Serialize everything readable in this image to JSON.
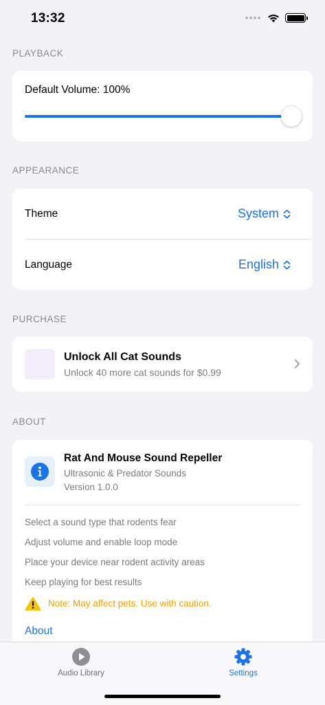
{
  "status_bar": {
    "time": "13:32"
  },
  "playback": {
    "header": "PLAYBACK",
    "volume_label": "Default Volume: 100%",
    "volume_value": 1.0
  },
  "appearance": {
    "header": "APPEARANCE",
    "theme_label": "Theme",
    "theme_value": "System",
    "language_label": "Language",
    "language_value": "English"
  },
  "purchase": {
    "header": "PURCHASE",
    "title": "Unlock All Cat Sounds",
    "subtitle": "Unlock 40 more cat sounds for $0.99"
  },
  "about": {
    "header": "ABOUT",
    "app_name": "Rat And Mouse Sound Repeller",
    "app_subtitle": "Ultrasonic & Predator Sounds",
    "version": "Version 1.0.0",
    "tips": [
      "Select a sound type that rodents fear",
      "Adjust volume and enable loop mode",
      "Place your device near rodent activity areas",
      "Keep playing for best results"
    ],
    "warning": "Note: May affect pets. Use with caution.",
    "about_link": "About"
  },
  "tab_bar": {
    "tabs": [
      {
        "label": "Audio Library",
        "icon": "play-circle-icon",
        "active": false
      },
      {
        "label": "Settings",
        "icon": "gear-icon",
        "active": true
      }
    ]
  },
  "colors": {
    "accent": "#1a73e8",
    "background": "#f2f2f7",
    "warning": "#f5a000",
    "secondary_text": "#7c7c80"
  }
}
